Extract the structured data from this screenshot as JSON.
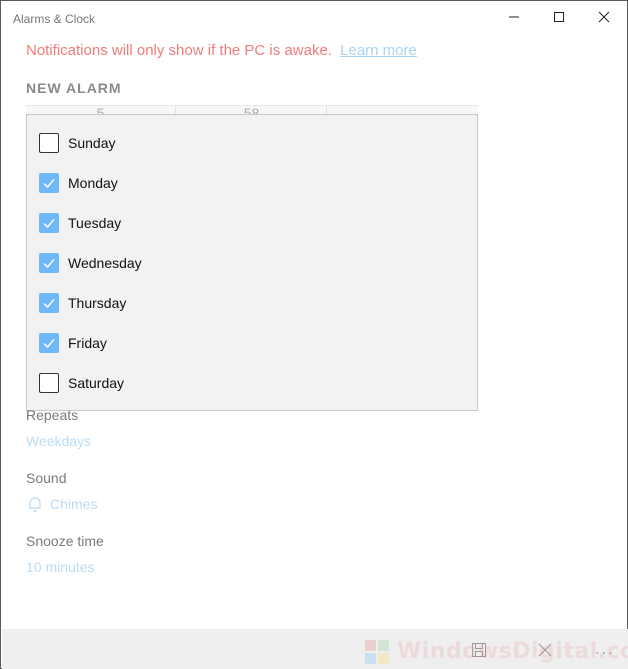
{
  "window": {
    "title": "Alarms & Clock",
    "controls": {
      "minimize": "minimize",
      "maximize": "maximize",
      "close": "close"
    }
  },
  "notice": {
    "text": "Notifications will only show if the PC is awake.",
    "link": "Learn more",
    "color": "#f07b7b",
    "link_color": "#a9d4f2"
  },
  "section_title": "NEW ALARM",
  "time_picker": {
    "hour": "5",
    "minute": "58",
    "period": ""
  },
  "repeat_days": [
    {
      "label": "Sunday",
      "checked": false
    },
    {
      "label": "Monday",
      "checked": true
    },
    {
      "label": "Tuesday",
      "checked": true
    },
    {
      "label": "Wednesday",
      "checked": true
    },
    {
      "label": "Thursday",
      "checked": true
    },
    {
      "label": "Friday",
      "checked": true
    },
    {
      "label": "Saturday",
      "checked": false
    }
  ],
  "fields": {
    "repeats": {
      "label": "Repeats",
      "value": "Weekdays"
    },
    "sound": {
      "label": "Sound",
      "value": "Chimes",
      "icon": "bell-icon"
    },
    "snooze": {
      "label": "Snooze time",
      "value": "10 minutes"
    }
  },
  "bottom_bar": {
    "save": "save-icon",
    "delete": "close-icon",
    "more": "more-icon",
    "more_glyph": "..."
  },
  "watermark": "WindowsDigital.com",
  "colors": {
    "accent": "#6fb9f6",
    "value_text": "#b8dcf6"
  }
}
